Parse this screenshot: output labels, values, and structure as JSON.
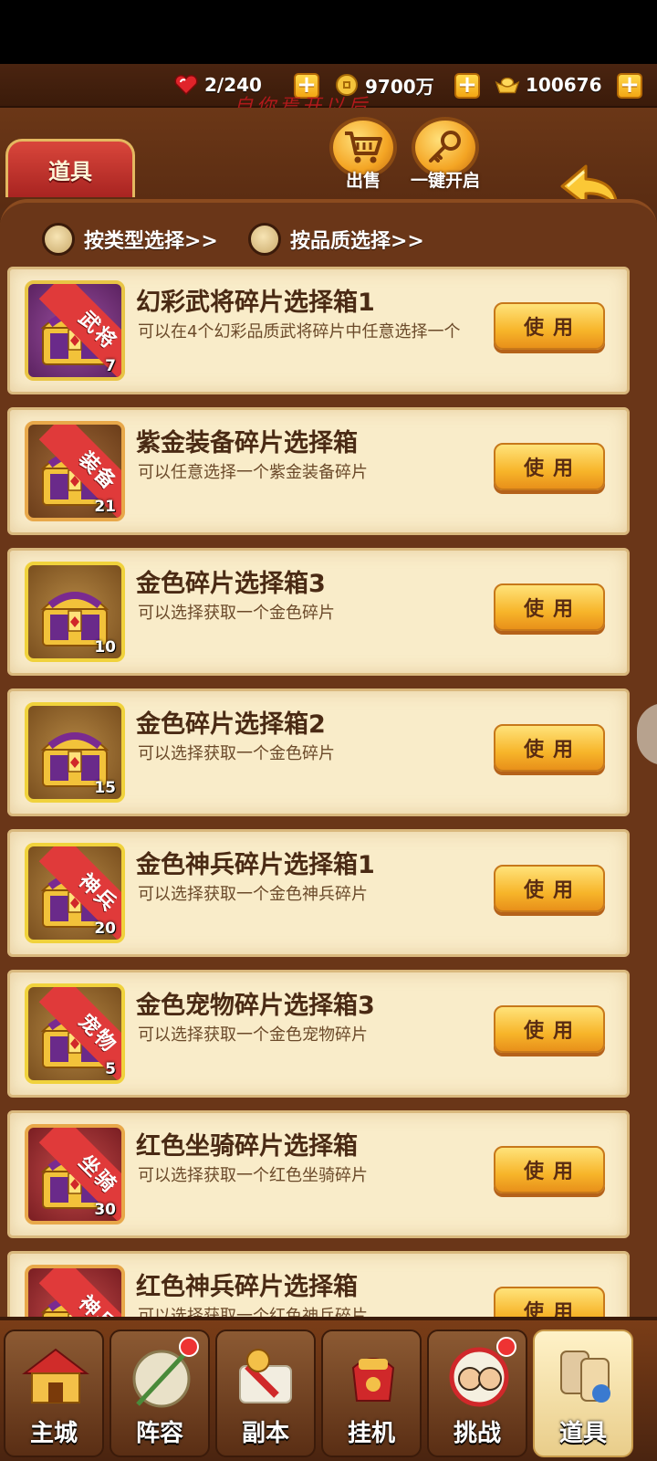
{
  "currency": {
    "stamina": "2/240",
    "coins": "9700万",
    "gold": "100676",
    "plus": "+"
  },
  "watermark": "自你焉开以后",
  "header": {
    "title": "道具",
    "sell_label": "出售",
    "open_all_label": "一键开启"
  },
  "filters": {
    "by_type": "按类型选择>>",
    "by_quality": "按品质选择>>"
  },
  "items": [
    {
      "name": "幻彩武将碎片选择箱1",
      "desc": "可以在4个幻彩品质武将碎片中任意选择一个",
      "tag": "武将",
      "qty": "7",
      "frame": "purple",
      "button": "使用"
    },
    {
      "name": "紫金装备碎片选择箱",
      "desc": "可以任意选择一个紫金装备碎片",
      "tag": "装备",
      "qty": "21",
      "frame": "brown",
      "button": "使用"
    },
    {
      "name": "金色碎片选择箱3",
      "desc": "可以选择获取一个金色碎片",
      "tag": "",
      "qty": "10",
      "frame": "gold",
      "button": "使用"
    },
    {
      "name": "金色碎片选择箱2",
      "desc": "可以选择获取一个金色碎片",
      "tag": "",
      "qty": "15",
      "frame": "gold",
      "button": "使用"
    },
    {
      "name": "金色神兵碎片选择箱1",
      "desc": "可以选择获取一个金色神兵碎片",
      "tag": "神兵",
      "qty": "20",
      "frame": "gold",
      "button": "使用"
    },
    {
      "name": "金色宠物碎片选择箱3",
      "desc": "可以选择获取一个金色宠物碎片",
      "tag": "宠物",
      "qty": "5",
      "frame": "gold",
      "button": "使用"
    },
    {
      "name": "红色坐骑碎片选择箱",
      "desc": "可以选择获取一个红色坐骑碎片",
      "tag": "坐骑",
      "qty": "30",
      "frame": "red",
      "button": "使用"
    },
    {
      "name": "红色神兵碎片选择箱",
      "desc": "可以选择获取一个红色神兵碎片",
      "tag": "神兵",
      "qty": "",
      "frame": "red",
      "button": "使用"
    }
  ],
  "nav": [
    {
      "label": "主城",
      "dot": false,
      "active": false
    },
    {
      "label": "阵容",
      "dot": true,
      "active": false
    },
    {
      "label": "副本",
      "dot": false,
      "active": false
    },
    {
      "label": "挂机",
      "dot": false,
      "active": false
    },
    {
      "label": "挑战",
      "dot": true,
      "active": false
    },
    {
      "label": "道具",
      "dot": false,
      "active": true
    }
  ]
}
